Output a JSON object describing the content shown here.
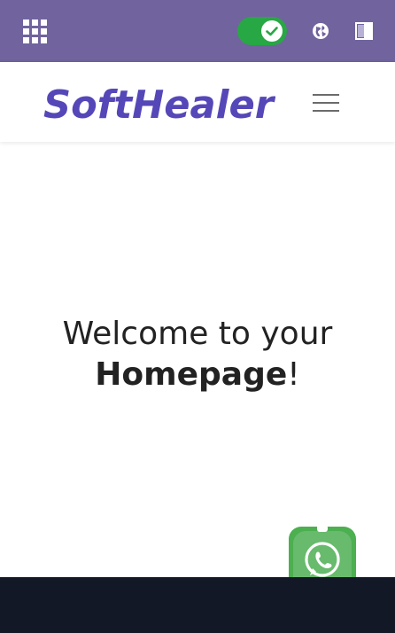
{
  "topbar": {
    "apps_icon": "apps-grid-icon",
    "toggle_state": "on",
    "toggle_color": "#28a745",
    "language_icon": "globe-icon",
    "panel_icon": "side-panel-icon",
    "background": "#71639e"
  },
  "navbar": {
    "logo_text": "SoftHealer",
    "logo_color": "#5547b8",
    "menu_icon": "hamburger-menu-icon"
  },
  "hero": {
    "line1": "Welcome to your",
    "strong": "Homepage",
    "suffix": "!"
  },
  "chat_widget": {
    "icon": "whatsapp-icon",
    "color": "#4caf50"
  },
  "footer": {
    "background": "#121826"
  }
}
